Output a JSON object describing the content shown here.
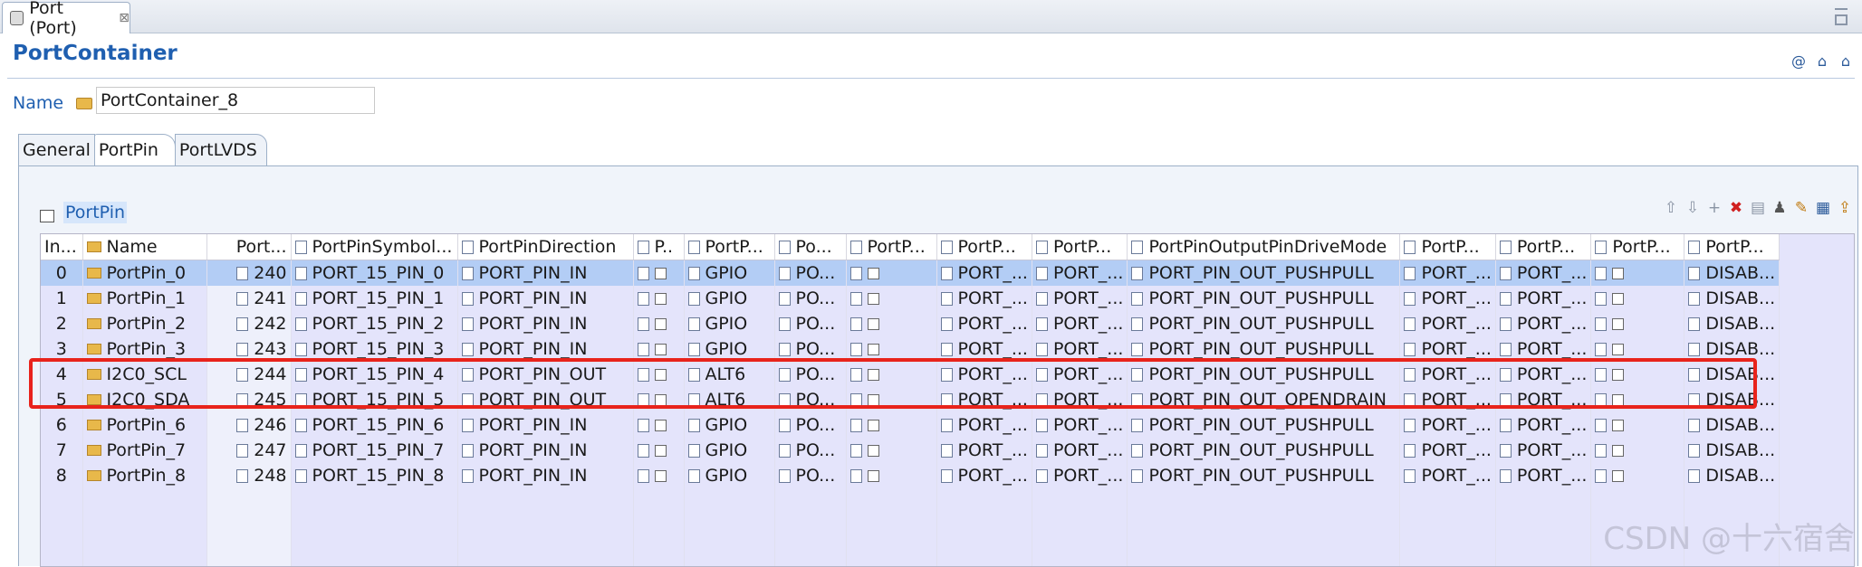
{
  "editor_tab": {
    "title": "Port (Port)",
    "close_glyph": "⊠"
  },
  "page": {
    "title": "PortContainer"
  },
  "name_field": {
    "label": "Name",
    "value": "PortContainer_8"
  },
  "tabs": [
    {
      "label": "General"
    },
    {
      "label": "PortPin"
    },
    {
      "label": "PortLVDS"
    }
  ],
  "section": {
    "title": "PortPin"
  },
  "columns": [
    "In...",
    "Name",
    "Port...",
    "PortPinSymbol...",
    "PortPinDirection",
    "P..",
    "PortP...",
    "Po...",
    "PortP...",
    "PortP...",
    "PortP...",
    "PortPinOutputPinDriveMode",
    "PortP...",
    "PortP...",
    "PortP...",
    "PortP..."
  ],
  "rows": [
    {
      "index": "0",
      "name": "PortPin_0",
      "id": "240",
      "symbol": "PORT_15_PIN_0",
      "dir": "PORT_PIN_IN",
      "mode": "GPIO",
      "po": "PO...",
      "p1": "PORT_...",
      "p2": "PORT_...",
      "drive": "PORT_PIN_OUT_PUSHPULL",
      "p3": "PORT_...",
      "p4": "PORT_...",
      "last": "DISAB..."
    },
    {
      "index": "1",
      "name": "PortPin_1",
      "id": "241",
      "symbol": "PORT_15_PIN_1",
      "dir": "PORT_PIN_IN",
      "mode": "GPIO",
      "po": "PO...",
      "p1": "PORT_...",
      "p2": "PORT_...",
      "drive": "PORT_PIN_OUT_PUSHPULL",
      "p3": "PORT_...",
      "p4": "PORT_...",
      "last": "DISAB..."
    },
    {
      "index": "2",
      "name": "PortPin_2",
      "id": "242",
      "symbol": "PORT_15_PIN_2",
      "dir": "PORT_PIN_IN",
      "mode": "GPIO",
      "po": "PO...",
      "p1": "PORT_...",
      "p2": "PORT_...",
      "drive": "PORT_PIN_OUT_PUSHPULL",
      "p3": "PORT_...",
      "p4": "PORT_...",
      "last": "DISAB..."
    },
    {
      "index": "3",
      "name": "PortPin_3",
      "id": "243",
      "symbol": "PORT_15_PIN_3",
      "dir": "PORT_PIN_IN",
      "mode": "GPIO",
      "po": "PO...",
      "p1": "PORT_...",
      "p2": "PORT_...",
      "drive": "PORT_PIN_OUT_PUSHPULL",
      "p3": "PORT_...",
      "p4": "PORT_...",
      "last": "DISAB..."
    },
    {
      "index": "4",
      "name": "I2C0_SCL",
      "id": "244",
      "symbol": "PORT_15_PIN_4",
      "dir": "PORT_PIN_OUT",
      "mode": "ALT6",
      "po": "PO...",
      "p1": "PORT_...",
      "p2": "PORT_...",
      "drive": "PORT_PIN_OUT_PUSHPULL",
      "p3": "PORT_...",
      "p4": "PORT_...",
      "last": "DISAB..."
    },
    {
      "index": "5",
      "name": "I2C0_SDA",
      "id": "245",
      "symbol": "PORT_15_PIN_5",
      "dir": "PORT_PIN_OUT",
      "mode": "ALT6",
      "po": "PO...",
      "p1": "PORT_...",
      "p2": "PORT_...",
      "drive": "PORT_PIN_OUT_OPENDRAIN",
      "p3": "PORT_...",
      "p4": "PORT_...",
      "last": "DISAB..."
    },
    {
      "index": "6",
      "name": "PortPin_6",
      "id": "246",
      "symbol": "PORT_15_PIN_6",
      "dir": "PORT_PIN_IN",
      "mode": "GPIO",
      "po": "PO...",
      "p1": "PORT_...",
      "p2": "PORT_...",
      "drive": "PORT_PIN_OUT_PUSHPULL",
      "p3": "PORT_...",
      "p4": "PORT_...",
      "last": "DISAB..."
    },
    {
      "index": "7",
      "name": "PortPin_7",
      "id": "247",
      "symbol": "PORT_15_PIN_7",
      "dir": "PORT_PIN_IN",
      "mode": "GPIO",
      "po": "PO...",
      "p1": "PORT_...",
      "p2": "PORT_...",
      "drive": "PORT_PIN_OUT_PUSHPULL",
      "p3": "PORT_...",
      "p4": "PORT_...",
      "last": "DISAB..."
    },
    {
      "index": "8",
      "name": "PortPin_8",
      "id": "248",
      "symbol": "PORT_15_PIN_8",
      "dir": "PORT_PIN_IN",
      "mode": "GPIO",
      "po": "PO...",
      "p1": "PORT_...",
      "p2": "PORT_...",
      "drive": "PORT_PIN_OUT_PUSHPULL",
      "p3": "PORT_...",
      "p4": "PORT_...",
      "last": "DISAB..."
    }
  ],
  "selected_row": 0,
  "highlight_color": "#e8231b",
  "watermark": "CSDN @十六宿舍",
  "icons": [
    "move-up-icon",
    "move-down-icon",
    "add-icon",
    "delete-icon",
    "copy-icon",
    "user-icon",
    "edit-icon",
    "table-edit-icon",
    "export-icon"
  ]
}
